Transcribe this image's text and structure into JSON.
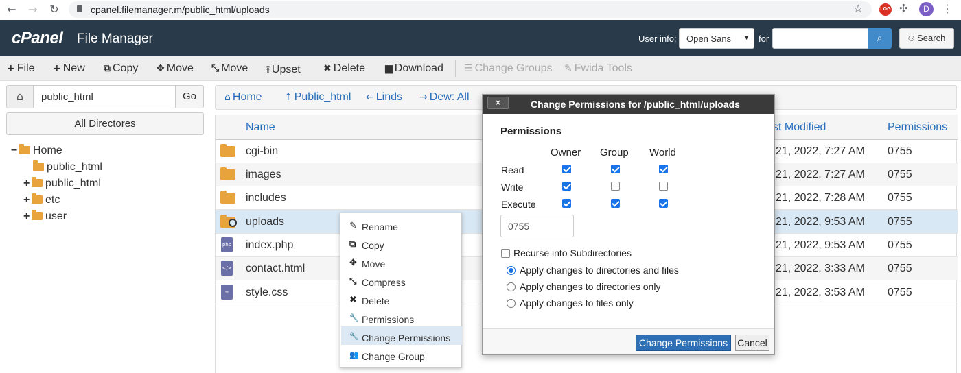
{
  "browser": {
    "url": "cpanel.filemanager.m/public_html/uploads",
    "back": "←",
    "forward": "→",
    "reload": "↻",
    "star": "☆",
    "extension_badge": "LOG",
    "puzzle": "✣",
    "profile_initial": "D",
    "menu": "⋮"
  },
  "header": {
    "logo": "cPanel",
    "app_title": "File Manager",
    "user_info_label": "User info:",
    "font_select_value": "Open Sans",
    "for_label": "for",
    "search_value": "",
    "search_button": "Search",
    "search_icon": "⌕",
    "search_btn_icon": "⚇"
  },
  "toolbar": {
    "items": [
      {
        "icon": "+",
        "label": "File"
      },
      {
        "icon": "+",
        "label": "New"
      },
      {
        "icon": "⧉",
        "label": "Copy"
      },
      {
        "icon": "✥",
        "label": "Move"
      },
      {
        "icon": "⤡",
        "label": "Move"
      },
      {
        "icon": "⭱",
        "label": "Upset"
      },
      {
        "icon": "✖",
        "label": "Delete"
      },
      {
        "icon": "▆",
        "label": "Download"
      },
      {
        "icon": "☰",
        "label": "Change Groups"
      },
      {
        "icon": "✎",
        "label": "Fwida Tools"
      }
    ]
  },
  "left": {
    "home_icon": "⌂",
    "path_value": "public_html",
    "go": "Go",
    "all_dirs": "All Directores",
    "tree": [
      {
        "sign": "−",
        "label": "Home"
      },
      {
        "sign": "",
        "label": "public_html"
      },
      {
        "sign": "+",
        "label": "public_html"
      },
      {
        "sign": "+",
        "label": "etc"
      },
      {
        "sign": "+",
        "label": "user"
      }
    ]
  },
  "rnav": {
    "items": [
      {
        "icon": "⌂",
        "label": "Home"
      },
      {
        "icon": "↑",
        "label": "Public_html"
      },
      {
        "icon": "←",
        "label": "Linds"
      },
      {
        "icon": "→",
        "label": "Dew: All"
      }
    ]
  },
  "table": {
    "columns": {
      "name": "Name",
      "modified": "st Modified",
      "permissions": "Permissions"
    },
    "rows": [
      {
        "name": "cgi-bin",
        "modified": "21, 2022, 7:27 AM",
        "perm": "0755"
      },
      {
        "name": "images",
        "modified": "21, 2022, 7:27 AM",
        "perm": "0755"
      },
      {
        "name": "includes",
        "modified": "21, 2022, 7:28 AM",
        "perm": "0755"
      },
      {
        "name": "uploads",
        "modified": "21, 2022, 9:53 AM",
        "perm": "0755"
      },
      {
        "name": "index.php",
        "modified": "21, 2022, 9:53 AM",
        "perm": "0755",
        "badge": "php"
      },
      {
        "name": "contact.html",
        "modified": "21, 2022, 3:33 AM",
        "perm": "0755",
        "badge": "</>"
      },
      {
        "name": "style.css",
        "modified": "21, 2022, 3:53 AM",
        "perm": "0755",
        "badge": "≡"
      }
    ]
  },
  "context_menu": {
    "items": [
      {
        "icon": "✎",
        "label": "Rename"
      },
      {
        "icon": "⧉",
        "label": "Copy"
      },
      {
        "icon": "✥",
        "label": "Move"
      },
      {
        "icon": "⤡",
        "label": "Compress"
      },
      {
        "icon": "✖",
        "label": "Delete"
      },
      {
        "icon": "🔧",
        "label": "Permissions"
      },
      {
        "icon": "🔧",
        "label": "Change Permissions"
      },
      {
        "icon": "👥",
        "label": "Change Group"
      }
    ]
  },
  "modal": {
    "close": "✕",
    "title": "Change Permissions for /public_html/uploads",
    "heading": "Permissions",
    "columns": [
      "Owner",
      "Group",
      "World"
    ],
    "rows": [
      {
        "label": "Read",
        "values": [
          true,
          true,
          true
        ]
      },
      {
        "label": "Write",
        "values": [
          true,
          false,
          false
        ]
      },
      {
        "label": "Execute",
        "values": [
          true,
          true,
          true
        ]
      }
    ],
    "octal": "0755",
    "recurse_label": "Recurse into Subdirectories",
    "recurse_checked": false,
    "apply_options": [
      {
        "label": "Apply changes to directories and files",
        "selected": true
      },
      {
        "label": "Apply changes to directories only",
        "selected": false
      },
      {
        "label": "Apply changes to files only",
        "selected": false
      }
    ],
    "confirm": "Change Permissions",
    "cancel": "Cancel"
  },
  "colors": {
    "header_bg": "#293a4a",
    "accent_blue": "#2a6ebb",
    "folder": "#e8a33d",
    "selected_row": "#d9e8f5"
  }
}
